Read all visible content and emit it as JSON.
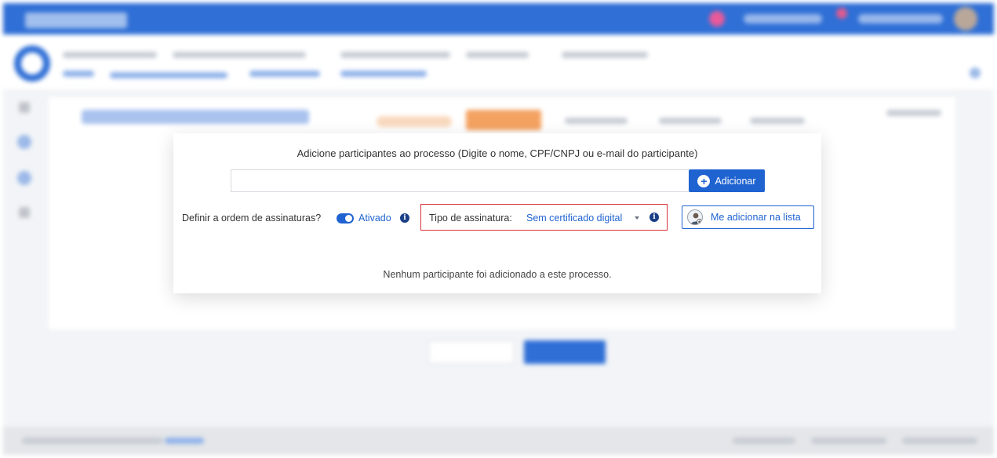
{
  "modal": {
    "title": "Adicione participantes ao processo (Digite o nome, CPF/CNPJ ou e-mail do participante)",
    "search_input_value": "",
    "add_button_label": "Adicionar",
    "signature_order_label": "Definir a ordem de assinaturas?",
    "signature_order_state": "Ativado",
    "signature_type_label": "Tipo de assinatura:",
    "signature_type_value": "Sem certificado digital",
    "add_me_button_label": "Me adicionar na lista",
    "empty_message": "Nenhum participante foi adicionado a este processo."
  },
  "icons": {
    "add": "plus-circle-icon",
    "info": "info-icon",
    "dropdown": "chevron-down-icon",
    "add_me": "user-add-icon"
  },
  "colors": {
    "primary": "#1f63d1",
    "highlight_border": "#d9303a",
    "topbar": "#2f6fd6"
  }
}
